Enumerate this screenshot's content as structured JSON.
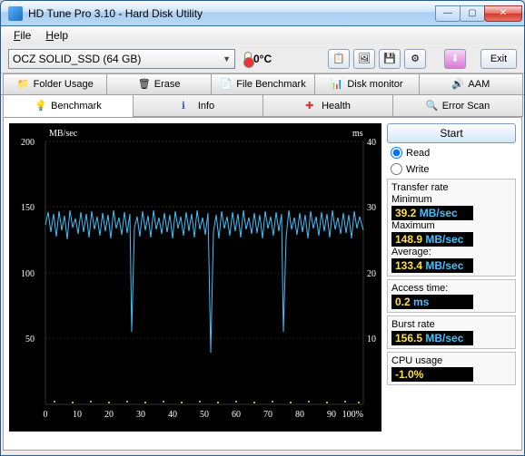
{
  "window": {
    "title": "HD Tune Pro 3.10 - Hard Disk Utility"
  },
  "menu": {
    "file": "File",
    "help": "Help"
  },
  "toolbar": {
    "drive": "OCZ SOLID_SSD (64 GB)",
    "temp": "0°C",
    "exit": "Exit"
  },
  "tabs_top": {
    "folder_usage": "Folder Usage",
    "erase": "Erase",
    "file_benchmark": "File Benchmark",
    "disk_monitor": "Disk monitor",
    "aam": "AAM"
  },
  "tabs_main": {
    "benchmark": "Benchmark",
    "info": "Info",
    "health": "Health",
    "error_scan": "Error Scan"
  },
  "controls": {
    "start": "Start",
    "read": "Read",
    "write": "Write"
  },
  "stats": {
    "transfer_rate_label": "Transfer rate",
    "min_label": "Minimum",
    "min_value": "39.2",
    "min_unit": "MB/sec",
    "max_label": "Maximum",
    "max_value": "148.9",
    "max_unit": "MB/sec",
    "avg_label": "Average:",
    "avg_value": "133.4",
    "avg_unit": "MB/sec",
    "access_label": "Access time:",
    "access_value": "0.2",
    "access_unit": "ms",
    "burst_label": "Burst rate",
    "burst_value": "156.5",
    "burst_unit": "MB/sec",
    "cpu_label": "CPU usage",
    "cpu_value": "-1.0%"
  },
  "chart_data": {
    "type": "line",
    "title": "",
    "xlabel": "%",
    "ylabel_left": "MB/sec",
    "ylabel_right": "ms",
    "xlim": [
      0,
      100
    ],
    "ylim_left": [
      0,
      200
    ],
    "ylim_right": [
      0,
      40
    ],
    "x_ticks": [
      0,
      10,
      20,
      30,
      40,
      50,
      60,
      70,
      80,
      90,
      "100%"
    ],
    "y_ticks_left": [
      50,
      100,
      150,
      200
    ],
    "y_ticks_right": [
      10,
      20,
      30,
      40
    ],
    "series": [
      {
        "name": "Transfer Rate",
        "color": "#3fc3ff",
        "average": 133.4,
        "minimum": 39.2,
        "maximum": 148.9,
        "note": "Dense noisy trace oscillating mostly 120-149 MB/sec with sharp dips near x≈27 to ~55, x≈53 to ~39, x≈75 to ~55"
      },
      {
        "name": "Access Time",
        "color": "#ffe040",
        "average": 0.2,
        "note": "Flat scatter near 0 ms along bottom"
      }
    ]
  }
}
